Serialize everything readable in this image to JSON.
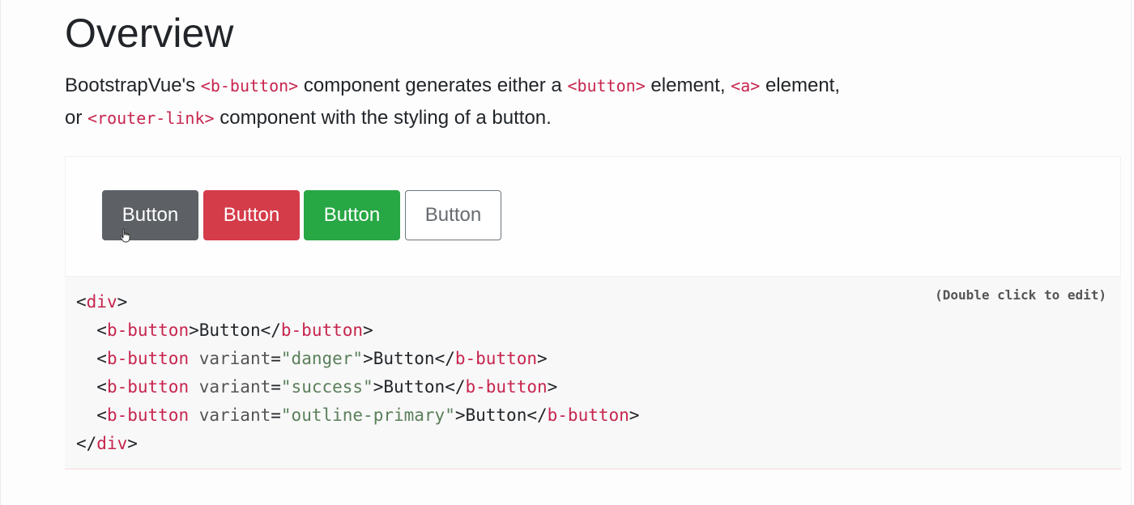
{
  "page": {
    "title": "Overview",
    "lead": [
      {
        "t": "text",
        "v": "BootstrapVue's "
      },
      {
        "t": "code",
        "v": "<b-button>"
      },
      {
        "t": "text",
        "v": " component generates either a "
      },
      {
        "t": "code",
        "v": "<button>"
      },
      {
        "t": "text",
        "v": " element, "
      },
      {
        "t": "code",
        "v": "<a>"
      },
      {
        "t": "text",
        "v": " element,"
      },
      {
        "t": "br"
      },
      {
        "t": "text",
        "v": "or "
      },
      {
        "t": "code",
        "v": "<router-link>"
      },
      {
        "t": "text",
        "v": " component with the styling of a button."
      }
    ]
  },
  "demo": {
    "buttons": [
      {
        "label": "Button",
        "variant": "secondary"
      },
      {
        "label": "Button",
        "variant": "danger"
      },
      {
        "label": "Button",
        "variant": "success"
      },
      {
        "label": "Button",
        "variant": "outline-primary"
      }
    ],
    "cursor": "hand-pointer-icon"
  },
  "code": {
    "edit_hint": "(Double click to edit)",
    "lines": [
      [
        {
          "c": "punc",
          "v": "<"
        },
        {
          "c": "tag",
          "v": "div"
        },
        {
          "c": "punc",
          "v": ">"
        }
      ],
      [
        {
          "c": "punc",
          "v": "  <"
        },
        {
          "c": "tag",
          "v": "b-button"
        },
        {
          "c": "punc",
          "v": ">Button</"
        },
        {
          "c": "tag",
          "v": "b-button"
        },
        {
          "c": "punc",
          "v": ">"
        }
      ],
      [
        {
          "c": "punc",
          "v": "  <"
        },
        {
          "c": "tag",
          "v": "b-button"
        },
        {
          "c": "attr",
          "v": " variant"
        },
        {
          "c": "punc",
          "v": "="
        },
        {
          "c": "str",
          "v": "\"danger\""
        },
        {
          "c": "punc",
          "v": ">Button</"
        },
        {
          "c": "tag",
          "v": "b-button"
        },
        {
          "c": "punc",
          "v": ">"
        }
      ],
      [
        {
          "c": "punc",
          "v": "  <"
        },
        {
          "c": "tag",
          "v": "b-button"
        },
        {
          "c": "attr",
          "v": " variant"
        },
        {
          "c": "punc",
          "v": "="
        },
        {
          "c": "str",
          "v": "\"success\""
        },
        {
          "c": "punc",
          "v": ">Button</"
        },
        {
          "c": "tag",
          "v": "b-button"
        },
        {
          "c": "punc",
          "v": ">"
        }
      ],
      [
        {
          "c": "punc",
          "v": "  <"
        },
        {
          "c": "tag",
          "v": "b-button"
        },
        {
          "c": "attr",
          "v": " variant"
        },
        {
          "c": "punc",
          "v": "="
        },
        {
          "c": "str",
          "v": "\"outline-primary\""
        },
        {
          "c": "punc",
          "v": ">Button</"
        },
        {
          "c": "tag",
          "v": "b-button"
        },
        {
          "c": "punc",
          "v": ">"
        }
      ],
      [
        {
          "c": "punc",
          "v": "</"
        },
        {
          "c": "tag",
          "v": "div"
        },
        {
          "c": "punc",
          "v": ">"
        }
      ]
    ]
  },
  "colors": {
    "secondary": "#5d6166",
    "danger": "#d53c4a",
    "success": "#28a745",
    "outline_border": "#6c757d",
    "code_tag": "#c7254e"
  }
}
